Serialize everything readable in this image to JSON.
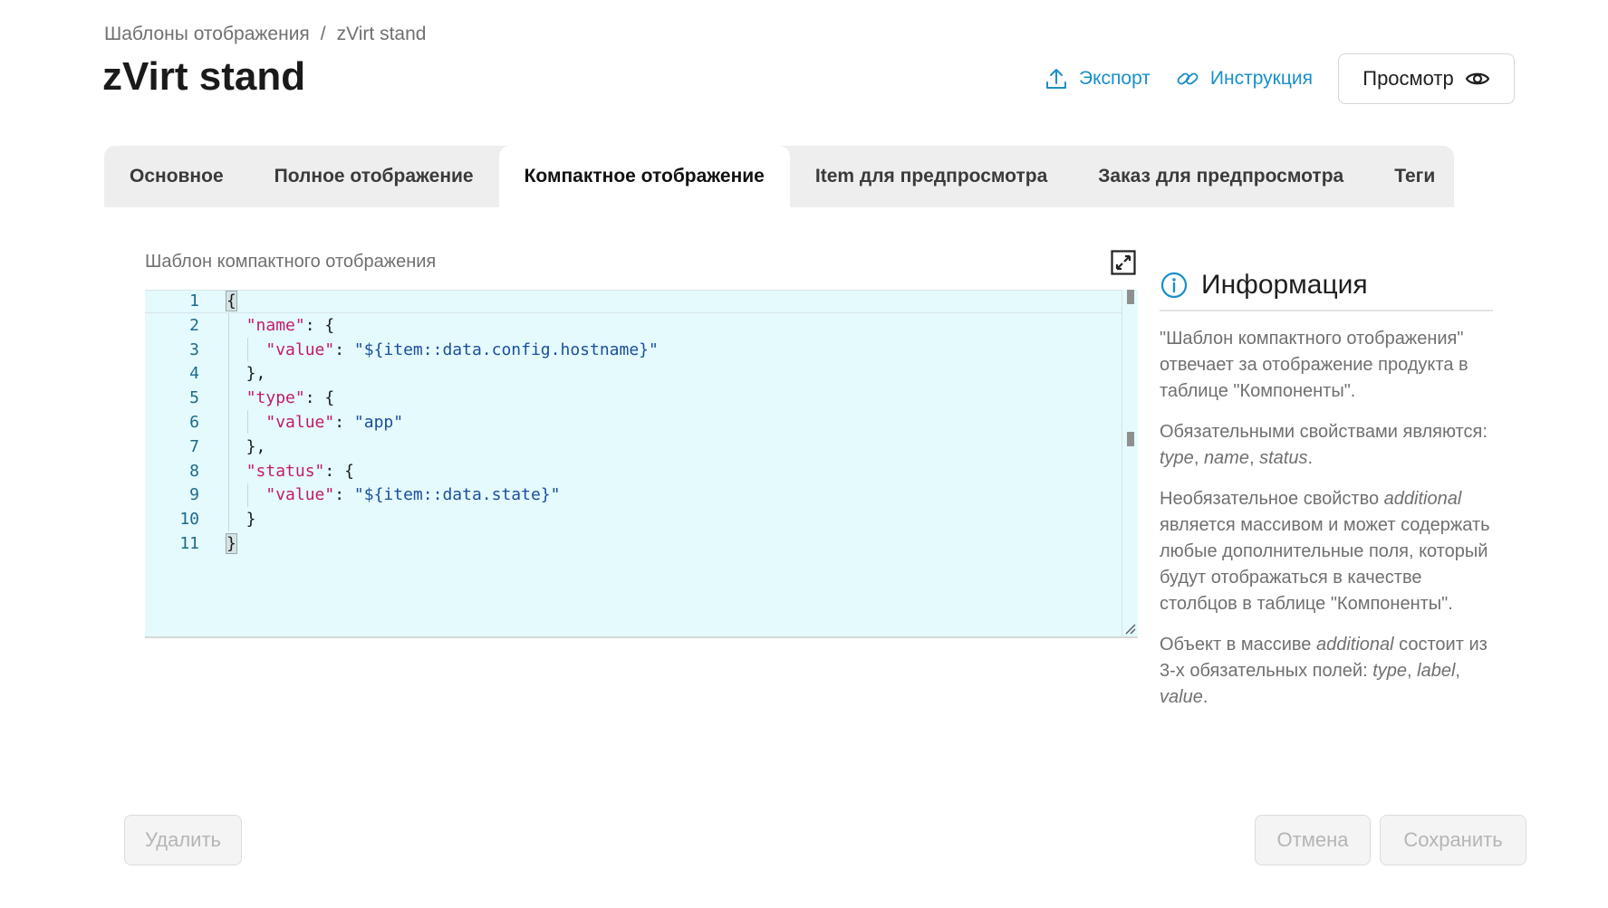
{
  "breadcrumb": {
    "parent": "Шаблоны отображения",
    "separator": "/",
    "current": "zVirt stand"
  },
  "page_title": "zVirt stand",
  "header_actions": {
    "export_label": "Экспорт",
    "instruction_label": "Инструкция",
    "preview_label": "Просмотр"
  },
  "tabs": [
    {
      "label": "Основное",
      "active": false
    },
    {
      "label": "Полное отображение",
      "active": false
    },
    {
      "label": "Компактное отображение",
      "active": true
    },
    {
      "label": "Item для предпросмотра",
      "active": false
    },
    {
      "label": "Заказ для предпросмотра",
      "active": false
    },
    {
      "label": "Теги",
      "active": false
    }
  ],
  "editor": {
    "label": "Шаблон компактного отображения",
    "line_numbers": [
      "1",
      "2",
      "3",
      "4",
      "5",
      "6",
      "7",
      "8",
      "9",
      "10",
      "11"
    ],
    "lines": [
      "{",
      "  \"name\": {",
      "    \"value\": \"${item::data.config.hostname}\"",
      "  },",
      "  \"type\": {",
      "    \"value\": \"app\"",
      "  },",
      "  \"status\": {",
      "    \"value\": \"${item::data.state}\"",
      "  }",
      "}"
    ]
  },
  "info": {
    "title": "Информация",
    "p1": "\"Шаблон компактного отображения\" отвечает за отображение продукта в таблице \"Компоненты\".",
    "p2_prefix": "Обязательными свойствами являются: ",
    "p2_items": [
      "type",
      "name",
      "status"
    ],
    "p3_prefix": "Необязательное свойство ",
    "p3_em": "additional",
    "p3_suffix": " является массивом и может содержать любые дополнительные поля, который будут отображаться в качестве столбцов в таблице \"Компоненты\".",
    "p4_prefix": "Объект в массиве ",
    "p4_em": "additional",
    "p4_mid": " состоит из 3-х обязательных полей: ",
    "p4_items": [
      "type",
      "label",
      "value"
    ]
  },
  "footer": {
    "delete_label": "Удалить",
    "cancel_label": "Отмена",
    "save_label": "Сохранить"
  },
  "colors": {
    "link": "#1a8fc9",
    "editor_bg": "#e4fafd",
    "json_key": "#c41a6b",
    "json_string": "#1a4f9c",
    "line_number": "#1d6a8a"
  },
  "icons": {
    "export": "upload-icon",
    "instruction": "link-icon",
    "preview": "eye-icon",
    "expand": "expand-icon",
    "info": "info-circle-icon"
  }
}
